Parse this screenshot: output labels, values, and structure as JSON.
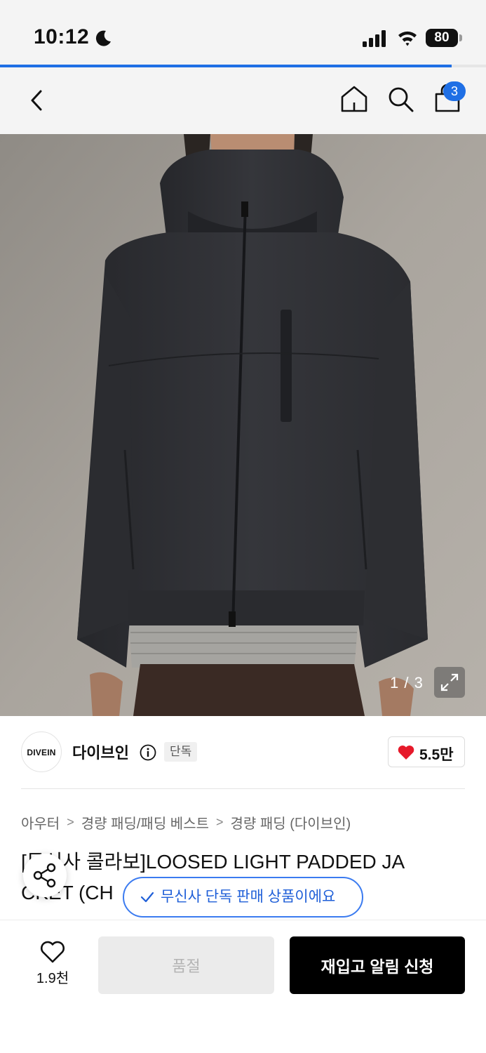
{
  "status_bar": {
    "time": "10:12",
    "battery": "80"
  },
  "page_progress": 0.93,
  "nav": {
    "cart_count": "3"
  },
  "gallery": {
    "counter": "1 / 3"
  },
  "brand": {
    "logo_text": "DIVEIN",
    "name": "다이브인",
    "exclusive_badge": "단독",
    "like_count": "5.5만"
  },
  "breadcrumb": [
    "아우터",
    "경량 패딩/패딩 베스트",
    "경량 패딩 (다이브인)"
  ],
  "product": {
    "title_line1": "[무신사 콜라보]LOOSED LIGHT PADDED JA",
    "title_line2": "CKET (CH"
  },
  "toast": {
    "text": "무신사 단독 판매 상품이에요"
  },
  "bottom_bar": {
    "wish_count": "1.9천",
    "soldout_label": "품절",
    "restock_label": "재입고 알림 신청"
  },
  "colors": {
    "accent": "#1f6fe5",
    "like_heart": "#e6192a",
    "jacket": "#2f3034"
  }
}
